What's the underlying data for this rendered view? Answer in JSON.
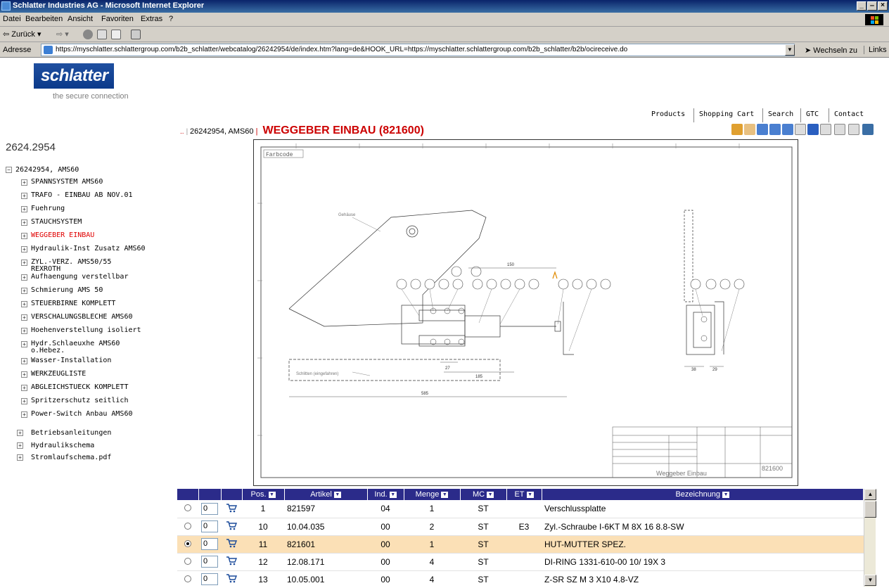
{
  "window": {
    "title": "Schlatter Industries AG - Microsoft Internet Explorer",
    "minimize": "_",
    "maximize": "̶",
    "close": "×"
  },
  "menu": [
    "Datei",
    "Bearbeiten",
    "Ansicht",
    "Favoriten",
    "Extras",
    "?"
  ],
  "toolbar": {
    "back_label": "Zurück"
  },
  "address": {
    "label": "Adresse",
    "url": "https://myschlatter.schlattergroup.com/b2b_schlatter/webcatalog/26242954/de/index.htm?lang=de&HOOK_URL=https://myschlatter.schlattergroup.com/b2b_schlatter/b2b/ocireceive.do",
    "go_label": "Wechseln zu",
    "links_label": "Links"
  },
  "brand": {
    "logo_text": "schlatter",
    "tagline": "the secure connection"
  },
  "topnav": [
    "Products",
    "Shopping Cart",
    "Search",
    "GTC",
    "Contact"
  ],
  "breadcrumb": {
    "prefix": "..",
    "path": "26242954, AMS60",
    "title": "WEGGEBER EINBAU (821600)"
  },
  "sidebar": {
    "heading": "2624.2954",
    "root": "26242954, AMS60",
    "items": [
      {
        "label": "SPANNSYSTEM AMS60",
        "active": false
      },
      {
        "label": "TRAFO - EINBAU AB NOV.01",
        "active": false
      },
      {
        "label": "Fuehrung",
        "active": false
      },
      {
        "label": "STAUCHSYSTEM",
        "active": false
      },
      {
        "label": "WEGGEBER EINBAU",
        "active": true
      },
      {
        "label": "Hydraulik-Inst Zusatz AMS60",
        "active": false
      },
      {
        "label": "ZYL.-VERZ. AMS50/55 REXROTH",
        "active": false
      },
      {
        "label": "Aufhaengung verstellbar",
        "active": false
      },
      {
        "label": "Schmierung AMS 50",
        "active": false
      },
      {
        "label": "STEUERBIRNE KOMPLETT",
        "active": false
      },
      {
        "label": "VERSCHALUNGSBLECHE AMS60",
        "active": false
      },
      {
        "label": "Hoehenverstellung isoliert",
        "active": false
      },
      {
        "label": "Hydr.Schlaeuxhe AMS60 o.Hebez.",
        "active": false
      },
      {
        "label": "Wasser-Installation",
        "active": false
      },
      {
        "label": "WERKZEUGLISTE",
        "active": false
      },
      {
        "label": "ABGLEICHSTUECK KOMPLETT",
        "active": false
      },
      {
        "label": "Spritzerschutz seitlich",
        "active": false
      },
      {
        "label": "Power-Switch Anbau AMS60",
        "active": false
      }
    ],
    "top_items": [
      "Betriebsanleitungen",
      "Hydraulikschema",
      "Stromlaufschema.pdf"
    ]
  },
  "drawing": {
    "farbcode": "Farbcode",
    "title_block_name": "Weggeber Einbau",
    "drawing_number": "821600",
    "dim_150": "150",
    "dim_585": "585",
    "dim_185": "185",
    "dim_27": "27",
    "dim_38": "38",
    "dim_29": "29",
    "note_gehaeuse": "Gehäuse",
    "note_schlitten": "Schlitten (eingefahren)"
  },
  "table": {
    "columns": [
      "Pos.",
      "Artikel",
      "Ind.",
      "Menge",
      "MC",
      "ET",
      "Bezeichnung"
    ],
    "rows": [
      {
        "qty": "0",
        "pos": "1",
        "artikel": "821597",
        "ind": "04",
        "menge": "1",
        "mc": "ST",
        "et": "",
        "bez": "Verschlussplatte",
        "selected": false
      },
      {
        "qty": "0",
        "pos": "10",
        "artikel": "10.04.035",
        "ind": "00",
        "menge": "2",
        "mc": "ST",
        "et": "E3",
        "bez": "Zyl.-Schraube I-6KT M 8X 16 8.8-SW",
        "selected": false
      },
      {
        "qty": "0",
        "pos": "11",
        "artikel": "821601",
        "ind": "00",
        "menge": "1",
        "mc": "ST",
        "et": "",
        "bez": "HUT-MUTTER SPEZ.",
        "selected": true
      },
      {
        "qty": "0",
        "pos": "12",
        "artikel": "12.08.171",
        "ind": "00",
        "menge": "4",
        "mc": "ST",
        "et": "",
        "bez": "DI-RING 1331-610-00 10/ 19X 3",
        "selected": false
      },
      {
        "qty": "0",
        "pos": "13",
        "artikel": "10.05.001",
        "ind": "00",
        "menge": "4",
        "mc": "ST",
        "et": "",
        "bez": "Z-SR SZ M 3 X10 4.8-VZ",
        "selected": false
      }
    ]
  },
  "colors": {
    "accent_red": "#e00000",
    "table_header": "#2b2b8a",
    "selected_row": "#fbe0b6",
    "logo_blue": "#1f4fa0"
  }
}
